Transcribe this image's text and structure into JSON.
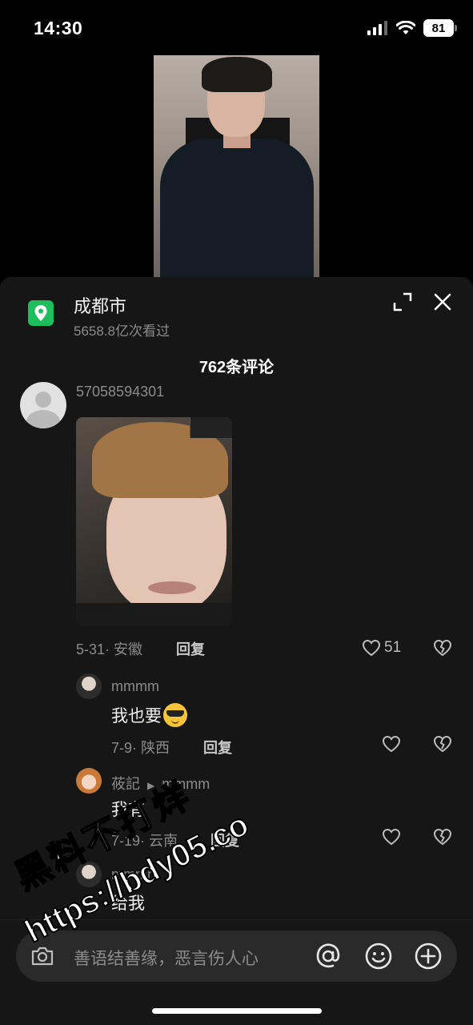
{
  "status_bar": {
    "time": "14:30",
    "battery": "81"
  },
  "location": {
    "title": "成都市",
    "subtitle": "5658.8亿次看过",
    "pin_icon": "location-pin-icon"
  },
  "header": {
    "comment_count": "762条评论"
  },
  "main_comment": {
    "username": "57058594301",
    "date_location": "5-31· 安徽",
    "reply_label": "回复",
    "likes": "51"
  },
  "replies": [
    {
      "name": "mmmm",
      "text": "我也要",
      "emoji": "sunglasses-emoji",
      "date_location": "7-9· 陕西",
      "reply_label": "回复"
    },
    {
      "name": "莜記",
      "reply_to": "mmmm",
      "text": "我有",
      "date_location": "7-19· 云南",
      "reply_label": "回复"
    },
    {
      "name": "mmmm",
      "text": "给我"
    }
  ],
  "input": {
    "placeholder": "善语结善缘，恶言伤人心"
  },
  "watermark": {
    "line1": "黑料不打烊",
    "line2": "https://bdy05.co"
  },
  "colors": {
    "sheet_bg": "#161616",
    "location_green": "#1fbe5c",
    "muted_text": "#8b8b8b"
  }
}
